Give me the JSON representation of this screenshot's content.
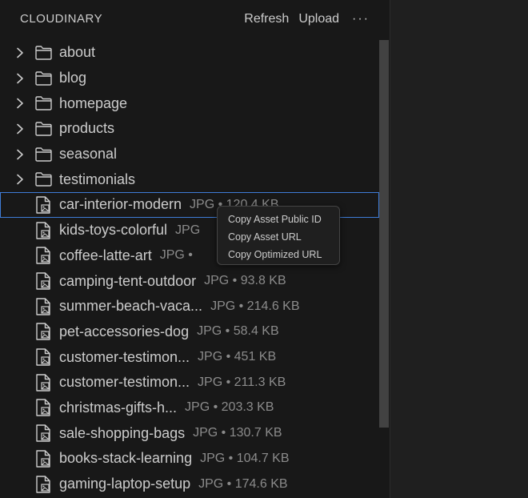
{
  "header": {
    "title": "CLOUDINARY",
    "refresh_label": "Refresh",
    "upload_label": "Upload",
    "more_label": "···"
  },
  "folders": [
    {
      "name": "about"
    },
    {
      "name": "blog"
    },
    {
      "name": "homepage"
    },
    {
      "name": "products"
    },
    {
      "name": "seasonal"
    },
    {
      "name": "testimonials"
    }
  ],
  "files": [
    {
      "name": "car-interior-modern",
      "meta": "JPG • 120.4 KB",
      "selected": true
    },
    {
      "name": "kids-toys-colorful",
      "meta": "JPG"
    },
    {
      "name": "coffee-latte-art",
      "meta": "JPG •"
    },
    {
      "name": "camping-tent-outdoor",
      "meta": "JPG • 93.8 KB"
    },
    {
      "name": "summer-beach-vaca...",
      "meta": "JPG • 214.6 KB"
    },
    {
      "name": "pet-accessories-dog",
      "meta": "JPG • 58.4 KB"
    },
    {
      "name": "customer-testimon...",
      "meta": "JPG • 451 KB"
    },
    {
      "name": "customer-testimon...",
      "meta": "JPG • 211.3 KB"
    },
    {
      "name": "christmas-gifts-h...",
      "meta": "JPG • 203.3 KB"
    },
    {
      "name": "sale-shopping-bags",
      "meta": "JPG • 130.7 KB"
    },
    {
      "name": "books-stack-learning",
      "meta": "JPG • 104.7 KB"
    },
    {
      "name": "gaming-laptop-setup",
      "meta": "JPG • 174.6 KB"
    }
  ],
  "context_menu": {
    "items": [
      "Copy Asset Public ID",
      "Copy Asset URL",
      "Copy Optimized URL"
    ]
  },
  "icons": {
    "chevron": "chevron-right-icon",
    "folder": "folder-icon",
    "file": "image-file-icon"
  },
  "colors": {
    "background": "#181818",
    "selection_outline": "#3e7cd6",
    "text": "#cccccc",
    "meta_text": "#8b8b8b"
  }
}
